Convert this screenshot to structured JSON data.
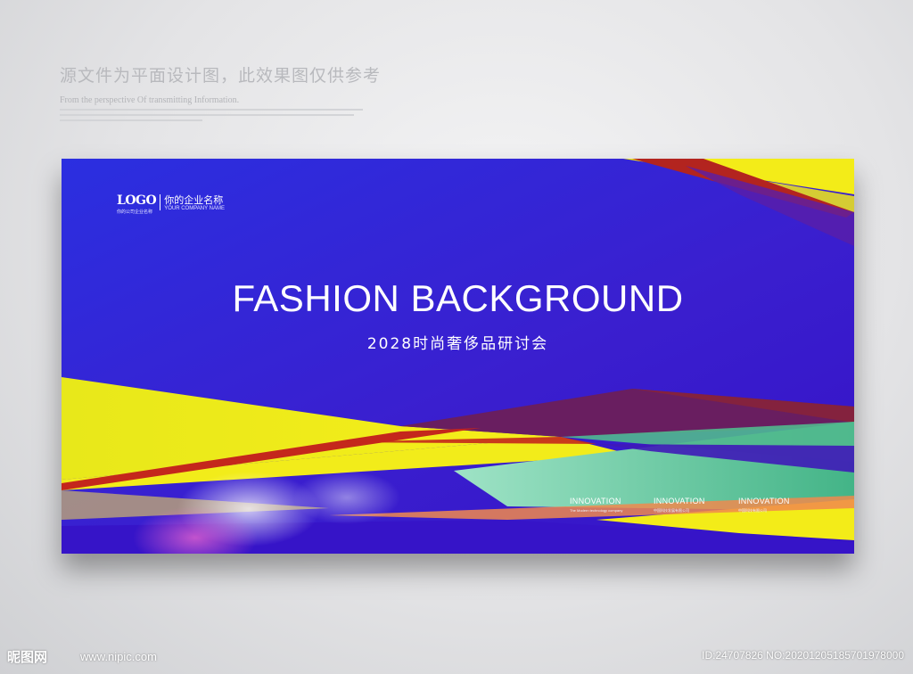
{
  "disclaimer": {
    "cn": "源文件为平面设计图，此效果图仅供参考",
    "en": "From the perspective Of transmitting Information."
  },
  "banner": {
    "logo_mark": "LOGO",
    "logo_mark_sub": "你的公司企业名称",
    "company_name": "你的企业名称",
    "company_name_en": "YOUR COMPANY NAME",
    "title": "FASHION BACKGROUND",
    "subtitle": "2028时尚奢侈品研讨会",
    "innovation": [
      {
        "heading": "INNOVATION",
        "desc": "The Modern technology company"
      },
      {
        "heading": "INNOVATION",
        "desc": "中国科技发展有限公司"
      },
      {
        "heading": "INNOVATION",
        "desc": "中国科技有限公司"
      }
    ],
    "colors": {
      "blue": "#3a1fcf",
      "yellow": "#f2ec16",
      "green": "#4fbf8c",
      "red": "#c0251c"
    }
  },
  "watermark": {
    "site_logo": "昵图网",
    "url": "www.nipic.com",
    "id_text": "ID:24707826 NO:20201205185701978000"
  }
}
